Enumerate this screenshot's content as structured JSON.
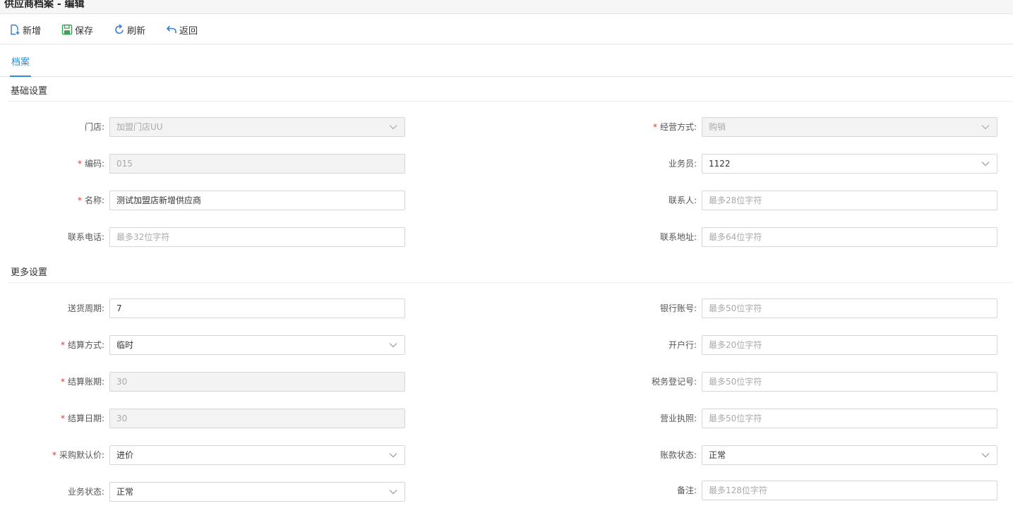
{
  "window": {
    "title": "供应商档案 - 编辑"
  },
  "toolbar": {
    "new_label": "新增",
    "save_label": "保存",
    "refresh_label": "刷新",
    "back_label": "返回"
  },
  "tabs": [
    {
      "label": "档案",
      "active": true
    }
  ],
  "sections": {
    "basic": "基础设置",
    "more": "更多设置"
  },
  "basic": {
    "store": {
      "label": "门店:",
      "value": "加盟门店UU",
      "required": false,
      "type": "select",
      "disabled": true
    },
    "business_mode": {
      "label": "经营方式:",
      "value": "购销",
      "required": true,
      "type": "select",
      "disabled": true
    },
    "code": {
      "label": "编码:",
      "value": "015",
      "required": true,
      "type": "text",
      "disabled": true
    },
    "salesman": {
      "label": "业务员:",
      "value": "1122",
      "required": false,
      "type": "select",
      "disabled": false
    },
    "name": {
      "label": "名称:",
      "value": "测试加盟店新增供应商",
      "required": true,
      "type": "text",
      "disabled": false
    },
    "contact": {
      "label": "联系人:",
      "placeholder": "最多28位字符",
      "required": false,
      "type": "text"
    },
    "phone": {
      "label": "联系电话:",
      "placeholder": "最多32位字符",
      "required": false,
      "type": "text"
    },
    "address": {
      "label": "联系地址:",
      "placeholder": "最多64位字符",
      "required": false,
      "type": "text"
    }
  },
  "more": {
    "delivery_cycle": {
      "label": "送货周期:",
      "value": "7",
      "required": false,
      "type": "text"
    },
    "bank_account": {
      "label": "银行账号:",
      "placeholder": "最多50位字符",
      "required": false,
      "type": "text"
    },
    "settle_method": {
      "label": "结算方式:",
      "value": "临时",
      "required": true,
      "type": "select"
    },
    "bank": {
      "label": "开户行:",
      "placeholder": "最多20位字符",
      "required": false,
      "type": "text"
    },
    "settle_period": {
      "label": "结算账期:",
      "value": "30",
      "required": true,
      "type": "text",
      "disabled": true
    },
    "tax_no": {
      "label": "税务登记号:",
      "placeholder": "最多50位字符",
      "required": false,
      "type": "text"
    },
    "settle_date": {
      "label": "结算日期:",
      "value": "30",
      "required": true,
      "type": "text",
      "disabled": true
    },
    "license": {
      "label": "营业执照:",
      "placeholder": "最多50位字符",
      "required": false,
      "type": "text"
    },
    "default_price": {
      "label": "采购默认价:",
      "value": "进价",
      "required": true,
      "type": "select"
    },
    "account_status": {
      "label": "账款状态:",
      "value": "正常",
      "required": false,
      "type": "select"
    },
    "biz_status": {
      "label": "业务状态:",
      "value": "正常",
      "required": false,
      "type": "select"
    },
    "remark": {
      "label": "备注:",
      "placeholder": "最多128位字符",
      "required": false,
      "type": "text"
    }
  },
  "colors": {
    "accent": "#2b8fd8",
    "required": "#e0362c",
    "save_icon": "#3aa655",
    "icon_blue": "#3c7cc8"
  },
  "icons": {
    "new": "new-doc-icon",
    "save": "save-icon",
    "refresh": "refresh-icon",
    "back": "back-arrow-icon",
    "dropdown": "chevron-down-icon"
  }
}
